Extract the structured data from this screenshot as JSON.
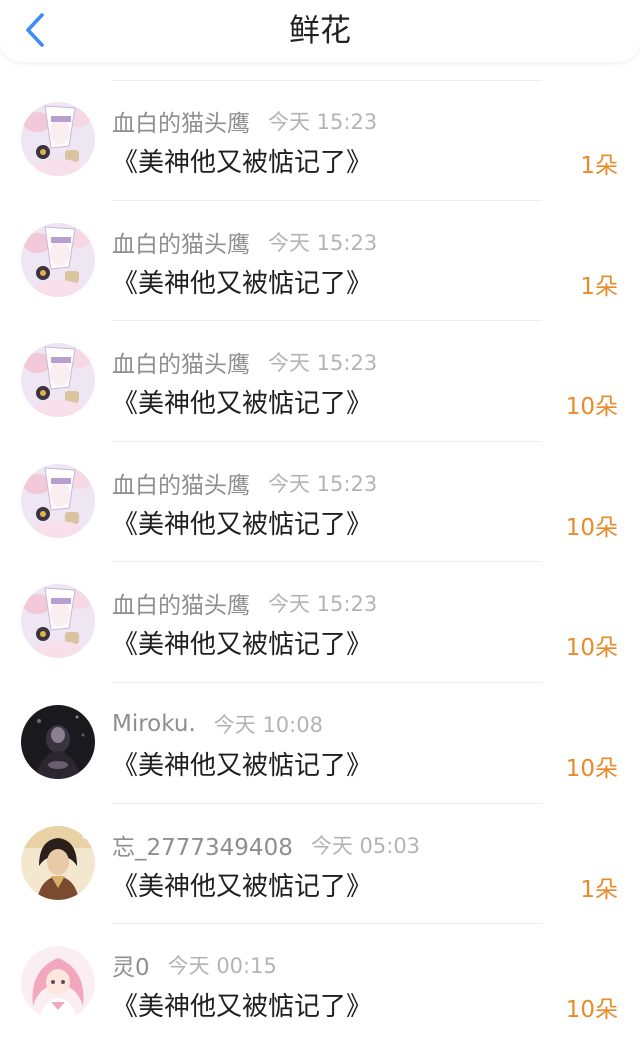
{
  "header": {
    "title": "鲜花",
    "back_icon": "chevron-left-icon",
    "accent_color": "#3a8ef6"
  },
  "colors": {
    "count": "#e88b2a",
    "username": "#8e8e93",
    "time": "#b4b4b8"
  },
  "items": [
    {
      "user": "血白的猫头鹰",
      "time": "今天 15:23",
      "book": "《美神他又被惦记了》",
      "count": "1朵",
      "avatar": "anime-owl-avatar"
    },
    {
      "user": "血白的猫头鹰",
      "time": "今天 15:23",
      "book": "《美神他又被惦记了》",
      "count": "1朵",
      "avatar": "anime-owl-avatar"
    },
    {
      "user": "血白的猫头鹰",
      "time": "今天 15:23",
      "book": "《美神他又被惦记了》",
      "count": "10朵",
      "avatar": "anime-owl-avatar"
    },
    {
      "user": "血白的猫头鹰",
      "time": "今天 15:23",
      "book": "《美神他又被惦记了》",
      "count": "10朵",
      "avatar": "anime-owl-avatar"
    },
    {
      "user": "血白的猫头鹰",
      "time": "今天 15:23",
      "book": "《美神他又被惦记了》",
      "count": "10朵",
      "avatar": "anime-owl-avatar"
    },
    {
      "user": "Miroku.",
      "time": "今天 10:08",
      "book": "《美神他又被惦记了》",
      "count": "10朵",
      "avatar": "dark-figure-avatar"
    },
    {
      "user": "忘_2777349408",
      "time": "今天 05:03",
      "book": "《美神他又被惦记了》",
      "count": "1朵",
      "avatar": "ancient-style-avatar"
    },
    {
      "user": "灵0",
      "time": "今天 00:15",
      "book": "《美神他又被惦记了》",
      "count": "10朵",
      "avatar": "pink-hair-avatar"
    }
  ]
}
